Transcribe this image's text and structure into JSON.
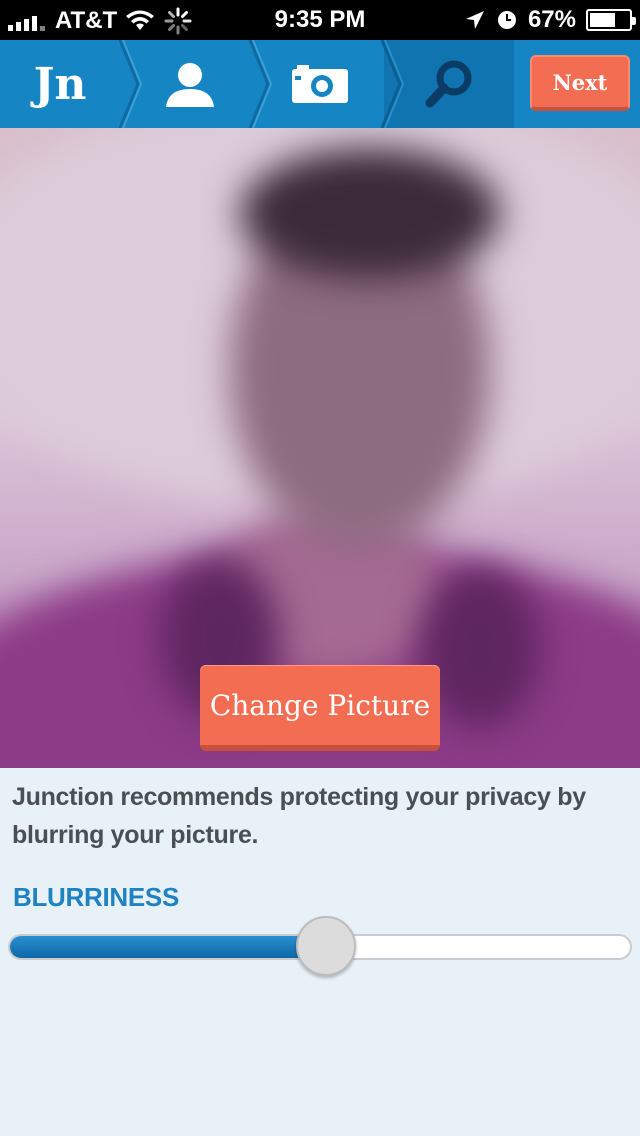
{
  "status_bar": {
    "carrier": "AT&T",
    "time": "9:35 PM",
    "battery": "67%",
    "battery_level": 0.67
  },
  "nav": {
    "logo": "Jn",
    "steps": [
      "profile-icon",
      "camera-icon",
      "search-icon"
    ],
    "next_label": "Next"
  },
  "photo": {
    "change_label": "Change Picture"
  },
  "content": {
    "description": "Junction recommends protecting your privacy by blurring your picture.",
    "slider_title": "BLURRINESS",
    "blurriness_value": 0.51
  },
  "colors": {
    "nav": "#1585c4",
    "accent": "#f36d53",
    "title": "#1f83c2"
  }
}
